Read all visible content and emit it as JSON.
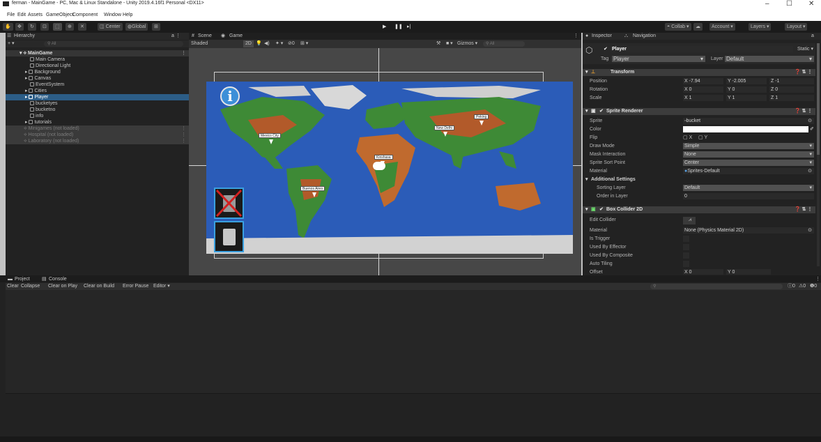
{
  "titlebar": {
    "title": "ferman - MainGame - PC, Mac & Linux Standalone - Unity 2019.4.16f1 Personal <DX11>",
    "minimize": "–",
    "maximize": "☐",
    "close": "✕"
  },
  "menubar": [
    "File",
    "Edit",
    "Assets",
    "GameObject",
    "Component",
    "Window",
    "Help"
  ],
  "toolbar": {
    "center": "Center",
    "global": "Global",
    "collab": "Collab ▾",
    "account": "Account ▾",
    "layers": "Layers ▾",
    "layout": "Layout ▾"
  },
  "hierarchy": {
    "tab": "Hierarchy",
    "search_placeholder": "All",
    "rows": [
      "MainGame",
      "Main Camera",
      "Directional Light",
      "Background",
      "Canvas",
      "EventSystem",
      "Cities",
      "Player",
      "bucketyes",
      "bucketno",
      "info",
      "tutorials",
      "Minigames (not loaded)",
      "Hospital (not loaded)",
      "Laboratory (not loaded)"
    ]
  },
  "scene": {
    "tab_scene": "Scene",
    "tab_game": "Game",
    "shading": "Shaded",
    "mode2d": "2D",
    "gizmos": "Gizmos ▾",
    "search_placeholder": "All",
    "cities": [
      "Mexico City",
      "New Delhi",
      "Peking",
      "Kinshasa",
      "Buenos Aires"
    ]
  },
  "inspector": {
    "tab": "Inspector",
    "tab2": "Navigation",
    "object_name": "Player",
    "static": "Static ▾",
    "tag_label": "Tag",
    "tag": "Player",
    "layer_label": "Layer",
    "layer": "Default",
    "transform": {
      "title": "Transform",
      "position_label": "Position",
      "rotation_label": "Rotation",
      "scale_label": "Scale",
      "position": [
        "X -7.94",
        "Y -2.005",
        "Z -1"
      ],
      "rotation": [
        "X 0",
        "Y 0",
        "Z 0"
      ],
      "scale": [
        "X 1",
        "Y 1",
        "Z 1"
      ]
    },
    "sprite_renderer": {
      "title": "Sprite Renderer",
      "sprite_label": "Sprite",
      "sprite": "bucket",
      "color_label": "Color",
      "flip_label": "Flip",
      "flip_x": "X",
      "flip_y": "Y",
      "draw_mode_label": "Draw Mode",
      "draw_mode": "Simple",
      "mask_label": "Mask Interaction",
      "mask": "None",
      "sort_point_label": "Sprite Sort Point",
      "sort_point": "Center",
      "material_label": "Material",
      "material": "Sprites-Default",
      "additional": "Additional Settings",
      "sorting_layer_label": "Sorting Layer",
      "sorting_layer": "Default",
      "order_label": "Order in Layer",
      "order": "0"
    },
    "box_collider": {
      "title": "Box Collider 2D",
      "edit_label": "Edit Collider",
      "material_label": "Material",
      "material": "None (Physics Material 2D)",
      "trigger_label": "Is Trigger",
      "effector_label": "Used By Effector",
      "composite_label": "Used By Composite",
      "tiling_label": "Auto Tiling",
      "offset_label": "Offset",
      "offset": [
        "X 0",
        "Y 0"
      ]
    }
  },
  "bottom": {
    "tab_project": "Project",
    "tab_console": "Console",
    "console_buttons": [
      "Clear",
      "Collapse",
      "Clear on Play",
      "Clear on Build",
      "Error Pause",
      "Editor ▾"
    ],
    "counts": [
      "0",
      "0",
      "0"
    ]
  },
  "colors": {
    "selection": "#2c5d87",
    "ocean": "#2b5cb8",
    "panel": "#222222"
  }
}
